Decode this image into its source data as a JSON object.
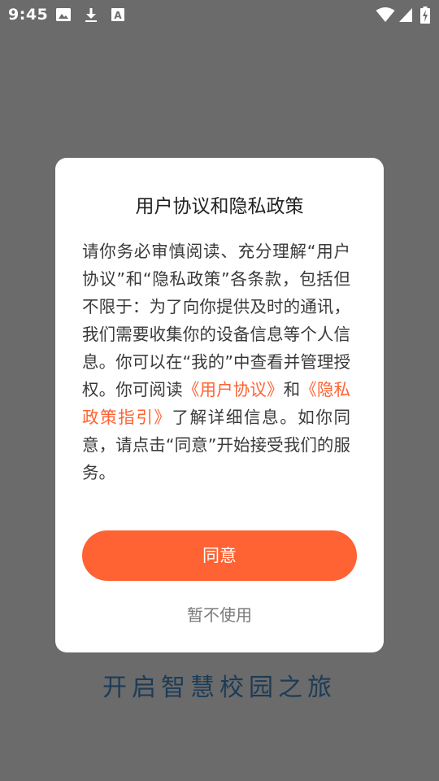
{
  "status_bar": {
    "time": "9:45",
    "icons": [
      "image-icon",
      "download-icon",
      "keyboard-a-icon",
      "wifi-icon",
      "signal-icon",
      "battery-charging-icon"
    ]
  },
  "dialog": {
    "title": "用户协议和隐私政策",
    "body_part1": "请你务必审慎阅读、充分理解“用户协议”和“隐私政策”各条款，包括但不限于：为了向你提供及时的通讯，我们需要收集你的设备信息等个人信息。你可以在“我的”中查看并管理授权。你可阅读",
    "link_user_agreement": "《用户协议》",
    "body_and": "和",
    "link_privacy_policy": "《隐私政策指引》",
    "body_part2": "了解详细信息。如你同意，请点击“同意”开始接受我们的服务。",
    "agree_label": "同意",
    "decline_label": "暂不使用"
  },
  "slogan": "开启智慧校园之旅",
  "colors": {
    "overlay": "#6b6b6b",
    "accent": "#ff6233",
    "slogan": "#1d3b57"
  }
}
